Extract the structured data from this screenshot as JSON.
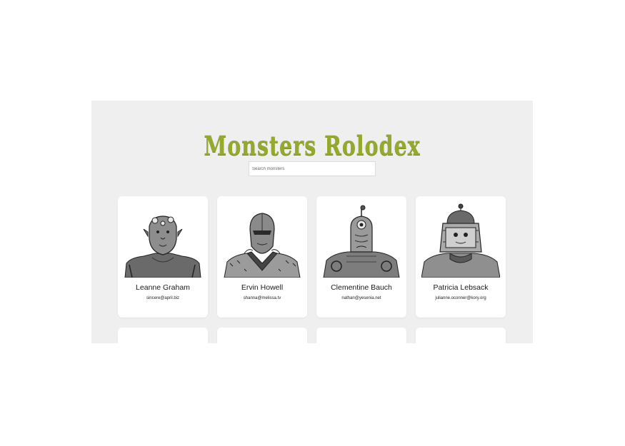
{
  "app": {
    "title": "Monsters Rolodex"
  },
  "search": {
    "placeholder": "Search monsters",
    "value": ""
  },
  "monsters": [
    {
      "name": "Leanne Graham",
      "email": "sincere@april.biz",
      "avatar_icon": "horned-monster-avatar"
    },
    {
      "name": "Ervin Howell",
      "email": "shanna@melissa.tv",
      "avatar_icon": "armored-knight-avatar"
    },
    {
      "name": "Clementine Bauch",
      "email": "nathan@yesenia.net",
      "avatar_icon": "cyclops-robot-avatar"
    },
    {
      "name": "Patricia Lebsack",
      "email": "julianne.oconner@kory.org",
      "avatar_icon": "helmet-robot-avatar"
    },
    {
      "name": "",
      "email": "",
      "avatar_icon": ""
    },
    {
      "name": "",
      "email": "",
      "avatar_icon": ""
    },
    {
      "name": "",
      "email": "",
      "avatar_icon": ""
    },
    {
      "name": "",
      "email": "",
      "avatar_icon": ""
    }
  ],
  "colors": {
    "title": "#95a92f",
    "panel_bg": "#efefef",
    "card_bg": "#ffffff"
  }
}
